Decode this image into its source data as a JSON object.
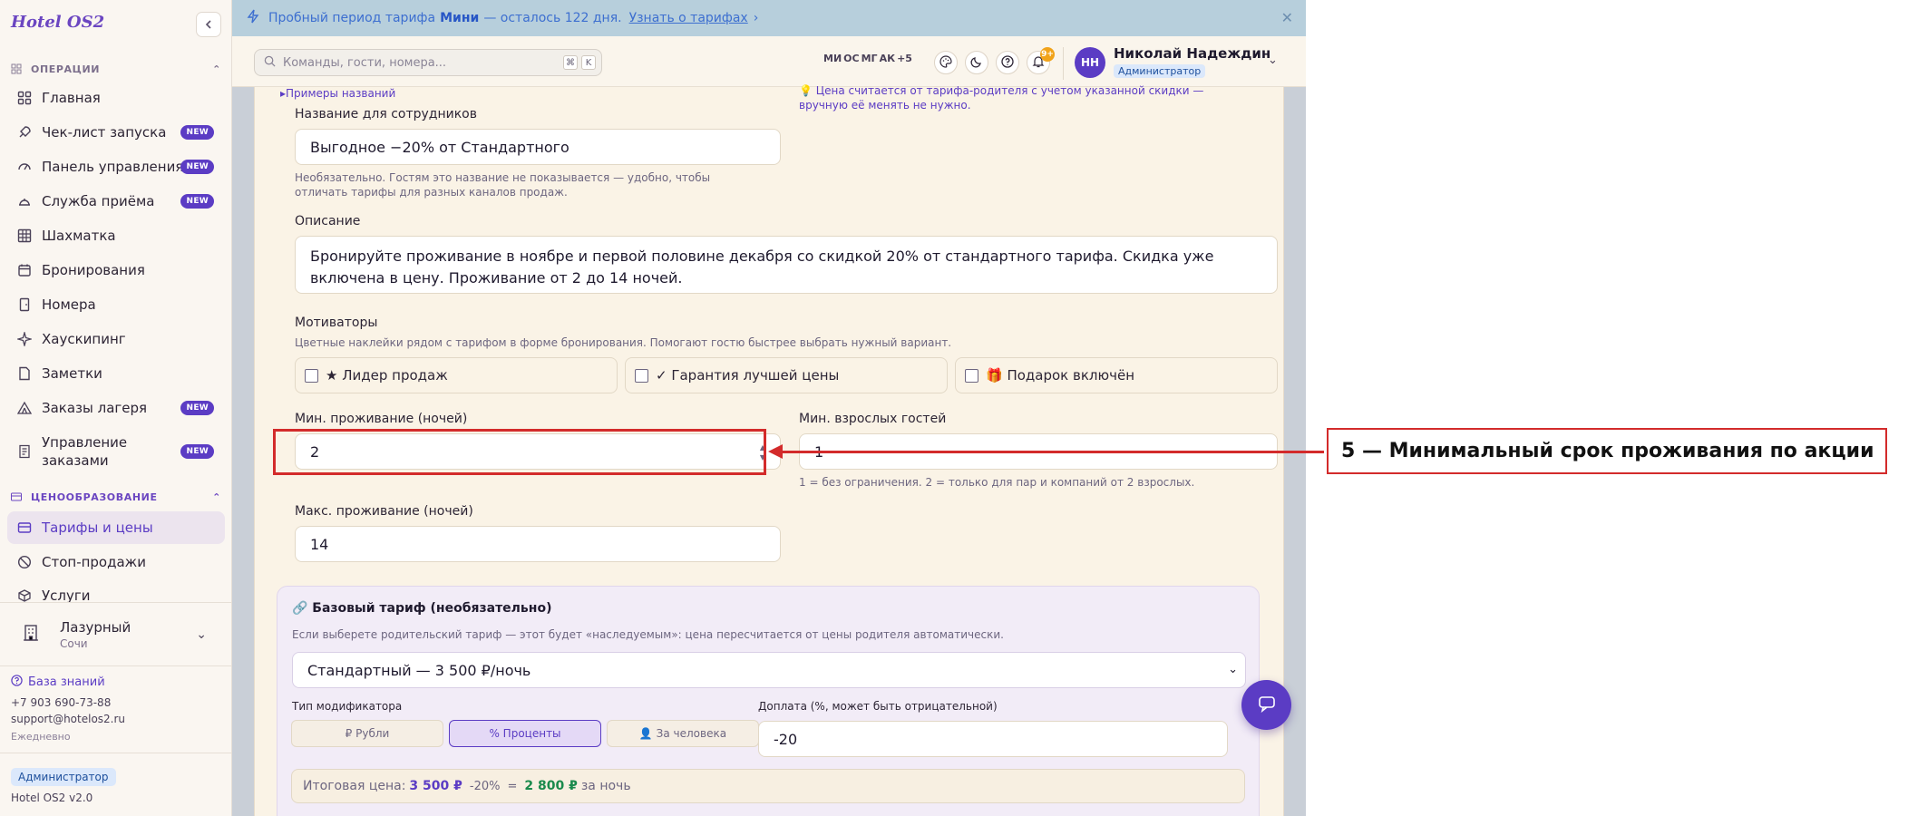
{
  "app": {
    "brand": "Hotel OS2"
  },
  "sidebar": {
    "sections": [
      {
        "label": "ОПЕРАЦИИ"
      },
      {
        "label": "ЦЕНООБРАЗОВАНИЕ"
      }
    ],
    "items": [
      {
        "label": "Главная",
        "icon": "grid-icon"
      },
      {
        "label": "Чек-лист запуска",
        "icon": "rocket-icon",
        "badge": "NEW"
      },
      {
        "label": "Панель управления",
        "icon": "gauge-icon",
        "badge": "NEW"
      },
      {
        "label": "Служба приёма",
        "icon": "bell-desk-icon",
        "badge": "NEW"
      },
      {
        "label": "Шахматка",
        "icon": "table-grid-icon"
      },
      {
        "label": "Бронирования",
        "icon": "calendar-icon"
      },
      {
        "label": "Номера",
        "icon": "door-icon"
      },
      {
        "label": "Хаускипинг",
        "icon": "sparkle-icon"
      },
      {
        "label": "Заметки",
        "icon": "note-icon"
      },
      {
        "label": "Заказы лагеря",
        "icon": "tent-icon",
        "badge": "NEW"
      },
      {
        "label": "Управление заказами",
        "icon": "receipt-icon",
        "badge": "NEW"
      },
      {
        "label": "Тарифы и цены",
        "icon": "card-icon"
      },
      {
        "label": "Стоп-продажи",
        "icon": "ban-icon"
      },
      {
        "label": "Услуги",
        "icon": "box-icon"
      }
    ],
    "hotel": {
      "name": "Лазурный",
      "city": "Сочи"
    },
    "knowledge_base": "База знаний",
    "support": {
      "phone": "+7 903 690-73-88",
      "email": "support@hotelos2.ru",
      "hours": "Ежедневно"
    },
    "role": "Администратор",
    "version": "Hotel OS2 v2.0"
  },
  "banner": {
    "text_before": "Пробный период тарифа",
    "plan": "Мини",
    "text_after": "— осталось 122 дня.",
    "link": "Узнать о тарифах"
  },
  "topbar": {
    "search_placeholder": "Команды, гости, номера...",
    "shortcut_keys": [
      "⌘",
      "K"
    ],
    "avatars": [
      "МИ",
      "ОС",
      "МГ",
      "АК",
      "+5"
    ],
    "notifications": "9+",
    "user": {
      "initials": "НН",
      "name": "Николай Надеждин",
      "role": "Администратор"
    }
  },
  "form": {
    "examples_link": "Примеры названий",
    "price_note": "Цена считается от тарифа-родителя с учетом указанной скидки — вручную её менять не нужно.",
    "staff_name": {
      "label": "Название для сотрудников",
      "value": "Выгодное −20% от Стандартного",
      "help": "Необязательно. Гостям это название не показывается — удобно, чтобы отличать тарифы для разных каналов продаж."
    },
    "description": {
      "label": "Описание",
      "value": "Бронируйте проживание в ноябре и первой половине декабря со скидкой 20% от стандартного тарифа. Скидка уже включена в цену. Проживание от 2 до 14 ночей."
    },
    "motivators": {
      "label": "Мотиваторы",
      "help": "Цветные наклейки рядом с тарифом в форме бронирования. Помогают гостю быстрее выбрать нужный вариант.",
      "items": [
        "★ Лидер продаж",
        "✓ Гарантия лучшей цены",
        "🎁 Подарок включён"
      ]
    },
    "min_stay": {
      "label": "Мин. проживание (ночей)",
      "value": "2"
    },
    "min_adults": {
      "label": "Мин. взрослых гостей",
      "value": "1",
      "help": "1 = без ограничения. 2 = только для пар и компаний от 2 взрослых."
    },
    "max_stay": {
      "label": "Макс. проживание (ночей)",
      "value": "14"
    },
    "base_rate": {
      "title": "🔗 Базовый тариф (необязательно)",
      "help": "Если выберете родительский тариф — этот будет «наследуемым»: цена пересчитается от цены родителя автоматически.",
      "selected": "Стандартный — 3 500 ₽/ночь",
      "modifier_label": "Тип модификатора",
      "modifiers": [
        "₽ Рубли",
        "% Проценты",
        "👤 За человека"
      ],
      "active_modifier": 1,
      "surcharge_label": "Доплата (%, может быть отрицательной)",
      "surcharge_value": "-20",
      "total_prefix": "Итоговая цена:",
      "total_base": "3 500 ₽",
      "total_mod": "-20%",
      "total_eq": "=",
      "total_result": "2 800 ₽",
      "total_suffix": "за ночь"
    }
  },
  "annotation": {
    "label": "5 — Минимальный срок проживания по акции"
  },
  "colors": {
    "accent": "#5b3cc4",
    "annotation": "#d32b2b",
    "banner": "#b7cfdc"
  }
}
